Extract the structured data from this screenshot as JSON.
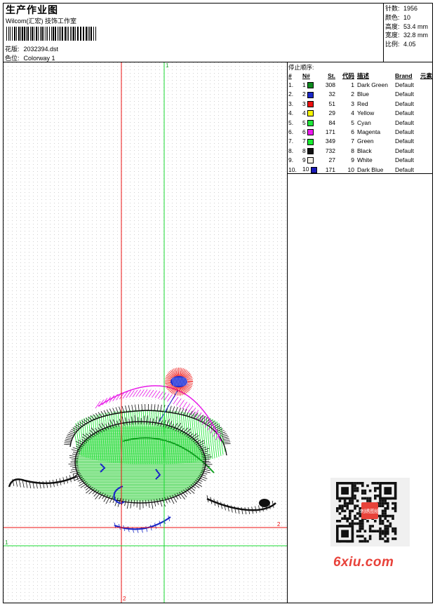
{
  "header": {
    "title": "生产作业图",
    "subtitle": "Wilcom(汇宏) 技饰工作室",
    "design_label": "花版:",
    "design_value": "2032394.dst",
    "colorway_label": "色位:",
    "colorway_value": "Colorway 1"
  },
  "stats": [
    {
      "label": "针数:",
      "value": "1956"
    },
    {
      "label": "颜色:",
      "value": "10"
    },
    {
      "label": "高度:",
      "value": "53.4 mm"
    },
    {
      "label": "宽度:",
      "value": "32.8 mm"
    },
    {
      "label": "比例:",
      "value": "4.05"
    }
  ],
  "sequence": {
    "title": "停止顺序:",
    "headers": [
      "#",
      "N#",
      "St.",
      "代码",
      "描述",
      "Brand",
      "元素"
    ],
    "rows": [
      {
        "idx": "1.",
        "n": "1",
        "color": "#0e8a1e",
        "st": "308",
        "code": "1",
        "desc": "Dark Green",
        "brand": "Default"
      },
      {
        "idx": "2.",
        "n": "2",
        "color": "#1a28c8",
        "st": "32",
        "code": "2",
        "desc": "Blue",
        "brand": "Default"
      },
      {
        "idx": "3.",
        "n": "3",
        "color": "#ee1010",
        "st": "51",
        "code": "3",
        "desc": "Red",
        "brand": "Default"
      },
      {
        "idx": "4.",
        "n": "4",
        "color": "#f5f500",
        "st": "29",
        "code": "4",
        "desc": "Yellow",
        "brand": "Default"
      },
      {
        "idx": "5.",
        "n": "5",
        "color": "#20e83a",
        "st": "84",
        "code": "5",
        "desc": "Cyan",
        "brand": "Default"
      },
      {
        "idx": "6.",
        "n": "6",
        "color": "#ee18ee",
        "st": "171",
        "code": "6",
        "desc": "Magenta",
        "brand": "Default"
      },
      {
        "idx": "7.",
        "n": "7",
        "color": "#18ee30",
        "st": "349",
        "code": "7",
        "desc": "Green",
        "brand": "Default"
      },
      {
        "idx": "8.",
        "n": "8",
        "color": "#101010",
        "st": "732",
        "code": "8",
        "desc": "Black",
        "brand": "Default"
      },
      {
        "idx": "9.",
        "n": "9",
        "color": "#f4f0e8",
        "st": "27",
        "code": "9",
        "desc": "White",
        "brand": "Default"
      },
      {
        "idx": "10.",
        "n": "10",
        "color": "#1a1ab8",
        "st": "171",
        "code": "10",
        "desc": "Dark Blue",
        "brand": "Default"
      }
    ]
  },
  "axes": {
    "green_top": "1",
    "green_left": "1",
    "red_bottom": "2",
    "red_right": "2"
  },
  "watermark": "6xiu.com",
  "qr_badge": "刺绣图纸"
}
